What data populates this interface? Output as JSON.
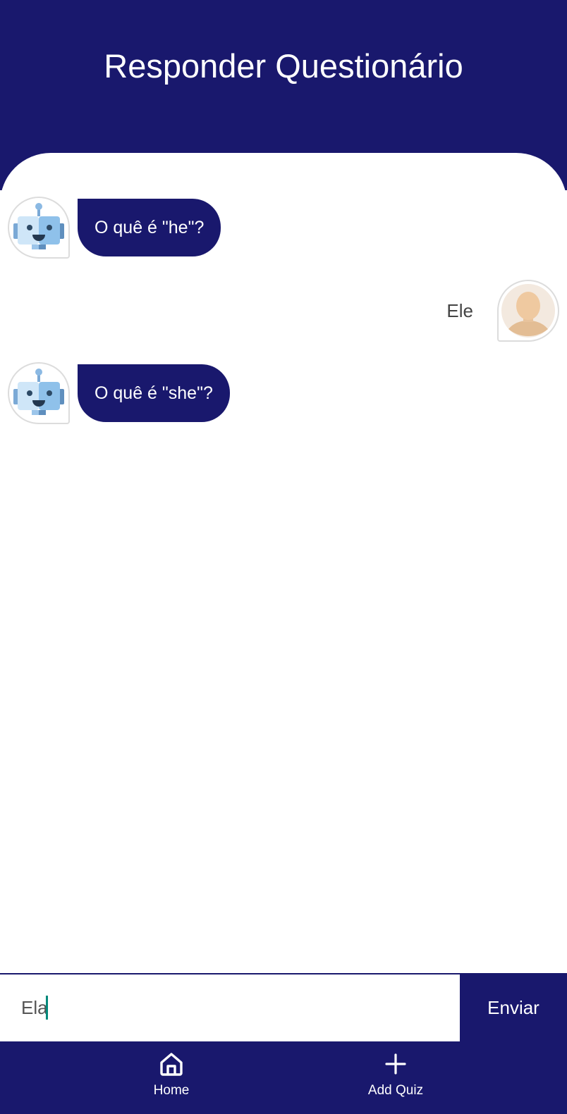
{
  "header": {
    "title": "Responder Questionário"
  },
  "chat": {
    "messages": [
      {
        "sender": "bot",
        "text": "O quê é \"he\"?",
        "avatar_icon": "robot-avatar-icon"
      },
      {
        "sender": "user",
        "text": "Ele",
        "avatar_icon": "user-avatar-icon"
      },
      {
        "sender": "bot",
        "text": "O quê é \"she\"?",
        "avatar_icon": "robot-avatar-icon"
      }
    ]
  },
  "input": {
    "value": "Ela",
    "send_label": "Enviar"
  },
  "nav": {
    "items": [
      {
        "label": "Home",
        "icon": "home-icon"
      },
      {
        "label": "Add Quiz",
        "icon": "plus-icon"
      }
    ]
  },
  "colors": {
    "primary": "#19186d",
    "background": "#ffffff",
    "caret": "#00897b",
    "avatar_border": "#dcdcdc"
  }
}
